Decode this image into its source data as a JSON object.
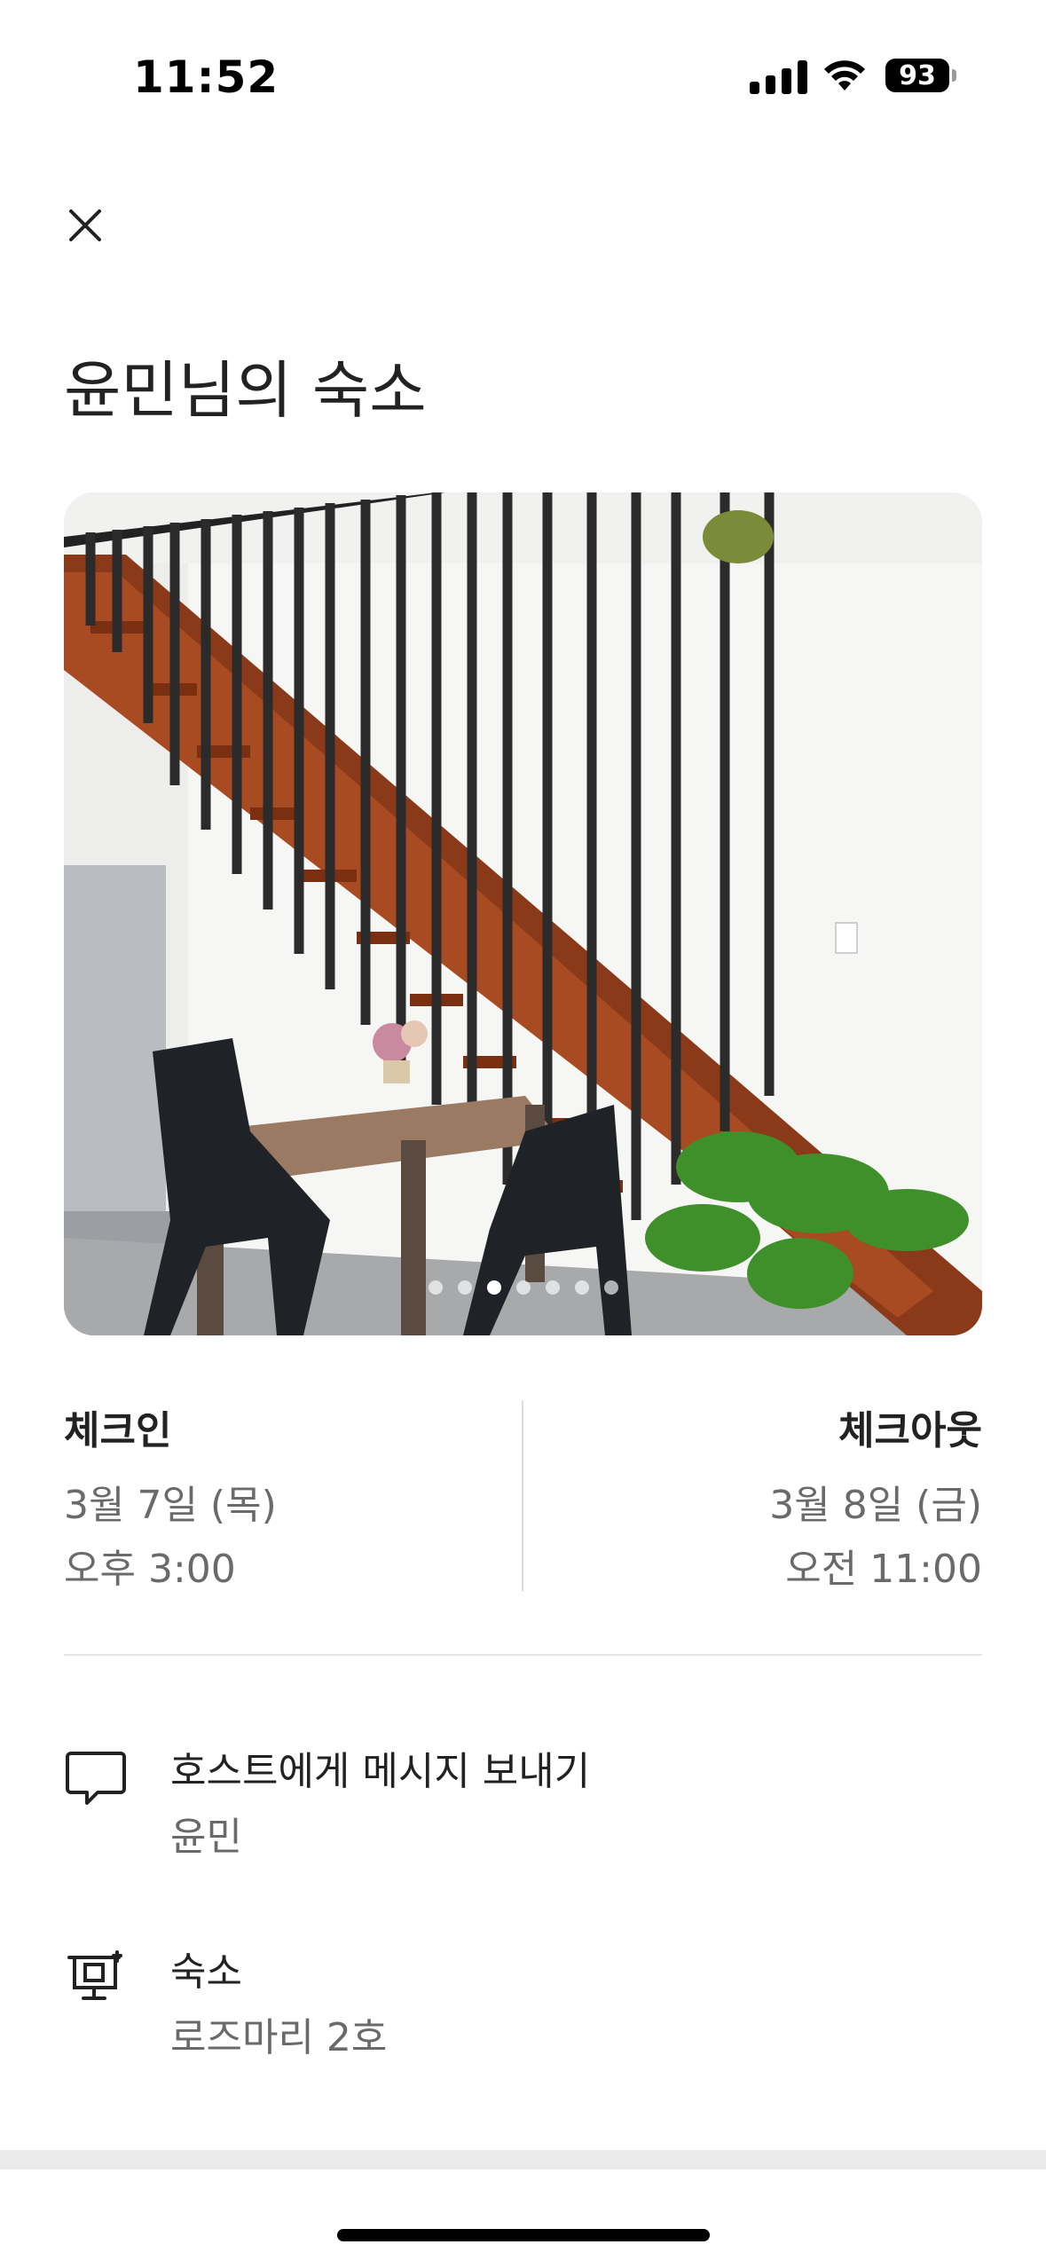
{
  "status_bar": {
    "time": "11:52",
    "battery": "93"
  },
  "header": {
    "close_icon": "close-icon",
    "title": "윤민님의 숙소"
  },
  "photo": {
    "description_icon": "listing-photo",
    "total_photos": 7,
    "active_index": 2
  },
  "checkin": {
    "label": "체크인",
    "date": "3월 7일 (목)",
    "time": "오후 3:00"
  },
  "checkout": {
    "label": "체크아웃",
    "date": "3월 8일 (금)",
    "time": "오전 11:00"
  },
  "message_host": {
    "icon": "message-icon",
    "title": "호스트에게 메시지 보내기",
    "subtitle": "윤민"
  },
  "listing": {
    "icon": "listing-icon",
    "title": "숙소",
    "subtitle": "로즈마리 2호"
  }
}
